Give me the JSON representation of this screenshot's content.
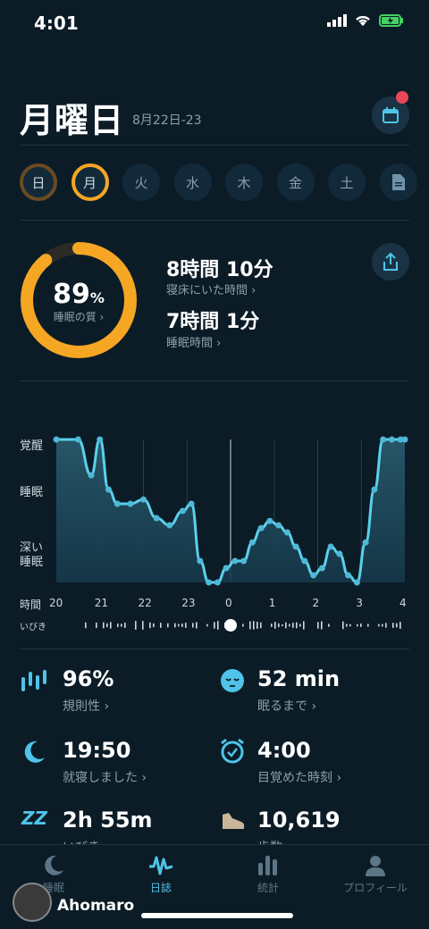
{
  "status": {
    "time": "4:01"
  },
  "header": {
    "title": "月曜日",
    "date": "8月22日-23"
  },
  "days": [
    "日",
    "月",
    "火",
    "水",
    "木",
    "金",
    "土"
  ],
  "summary": {
    "quality_value": "89",
    "quality_unit": "%",
    "quality_label": "睡眠の質 ›",
    "quality_fraction": 0.89,
    "in_bed_value": "8時間 10分",
    "in_bed_label": "寝床にいた時間 ›",
    "sleep_value": "7時間 1分",
    "sleep_label": "睡眠時間 ›"
  },
  "chart_data": {
    "type": "line",
    "y_categories": [
      "覚醒",
      "睡眠",
      "深い睡眠"
    ],
    "y_axis_labels": [
      "覚醒",
      "睡眠",
      "深い\n睡眠"
    ],
    "x_label": "時間",
    "x_ticks": [
      "20",
      "21",
      "22",
      "23",
      "0",
      "1",
      "2",
      "3",
      "4"
    ],
    "snore_label": "いびき",
    "x": [
      20.0,
      20.5,
      20.8,
      21.0,
      21.2,
      21.4,
      21.7,
      22.0,
      22.3,
      22.6,
      22.9,
      23.1,
      23.3,
      23.5,
      23.7,
      23.9,
      24.1,
      24.3,
      24.5,
      24.7,
      24.9,
      25.1,
      25.3,
      25.5,
      25.7,
      25.9,
      26.1,
      26.3,
      26.5,
      26.7,
      26.9,
      27.1,
      27.3,
      27.5,
      27.7,
      27.9,
      28.0
    ],
    "y": [
      0.0,
      0.0,
      0.25,
      0.0,
      0.35,
      0.45,
      0.45,
      0.42,
      0.55,
      0.6,
      0.5,
      0.45,
      0.85,
      1.0,
      1.0,
      0.9,
      0.85,
      0.85,
      0.72,
      0.62,
      0.57,
      0.6,
      0.65,
      0.75,
      0.85,
      0.95,
      0.9,
      0.75,
      0.8,
      0.95,
      1.0,
      0.72,
      0.35,
      0.0,
      0.0,
      0.0,
      0.0
    ],
    "y_scale": "0 = 覚醒, 0.35 = 睡眠, 1 = 深い睡眠"
  },
  "metrics": [
    {
      "value": "96%",
      "label": "規則性 ›",
      "icon": "regularity-icon"
    },
    {
      "value": "52 min",
      "label": "眠るまで ›",
      "icon": "sleepy-face-icon"
    },
    {
      "value": "19:50",
      "label": "就寝しました ›",
      "icon": "moon-icon"
    },
    {
      "value": "4:00",
      "label": "目覚めた時刻 ›",
      "icon": "alarm-clock-icon"
    },
    {
      "value": "2h 55m",
      "label": "いびき ›",
      "icon": "zzz-icon"
    },
    {
      "value": "10,619",
      "label": "歩数 ›",
      "icon": "shoe-icon"
    }
  ],
  "nav": [
    {
      "label": "睡眠",
      "icon": "moon-icon"
    },
    {
      "label": "日誌",
      "icon": "wave-icon"
    },
    {
      "label": "統計",
      "icon": "bars-icon"
    },
    {
      "label": "プロフィール",
      "icon": "person-icon"
    }
  ],
  "watermark": "Ahomaro",
  "colors": {
    "accent": "#4fc3e8",
    "ring_orange": "#f5a623",
    "ring_yellow": "#f7c744",
    "bg": "#0b1c27"
  }
}
